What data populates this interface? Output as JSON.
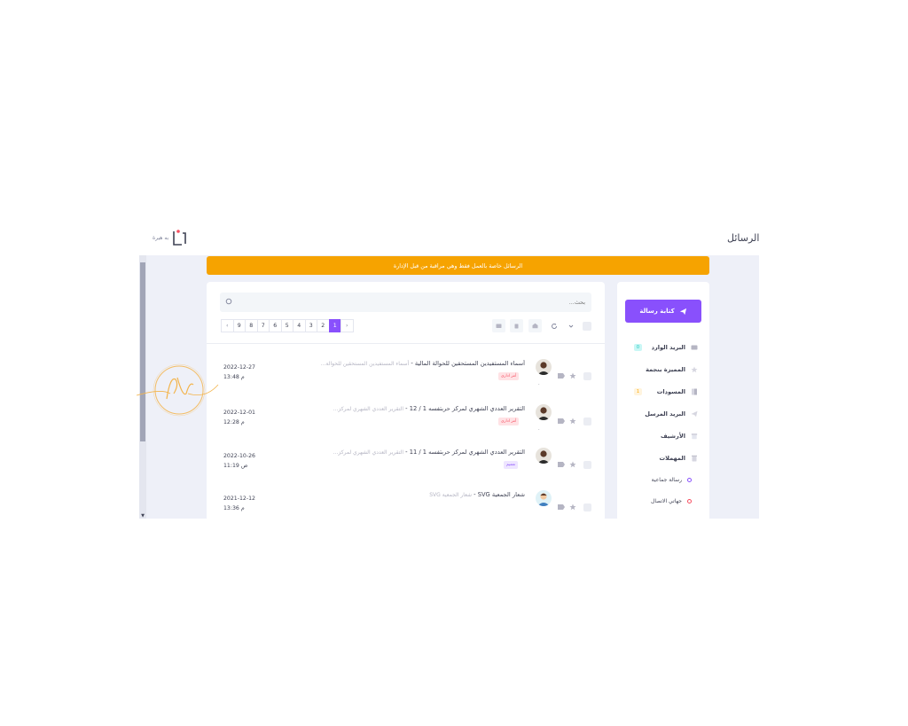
{
  "page": {
    "title": "الرسائل"
  },
  "logo": {
    "text": "به هيرة"
  },
  "notice": {
    "text": "الرسائل خاصة بالعمل فقط وهي مراقبة من قبل الإدارة"
  },
  "sidebar": {
    "compose_label": "كتابة رسالة",
    "items": [
      {
        "label": "البريد الوارد",
        "badge": "0",
        "icon": "inbox-icon"
      },
      {
        "label": "المميزة بنجمة",
        "badge": "",
        "icon": "star-icon"
      },
      {
        "label": "المسودات",
        "badge": "1",
        "icon": "draft-icon"
      },
      {
        "label": "البريد المرسل",
        "badge": "",
        "icon": "send-icon"
      },
      {
        "label": "الأرشيف",
        "badge": "",
        "icon": "archive-icon"
      },
      {
        "label": "المهملات",
        "badge": "",
        "icon": "trash-icon"
      }
    ],
    "labels": [
      {
        "label": "رسالة جماعية",
        "color": "#8950fc"
      },
      {
        "label": "جهاتي الاتصال",
        "color": "#f64e60"
      }
    ]
  },
  "search": {
    "placeholder": "بحث..."
  },
  "pagination": {
    "pages": [
      "1",
      "2",
      "3",
      "4",
      "5",
      "6",
      "7",
      "8",
      "9"
    ],
    "current": "1",
    "prev": "‹",
    "next": "›"
  },
  "messages": [
    {
      "subject": "أسماء المستفيدين المستحقين للحوالة المالية",
      "snippet": "أسماء المستفيدين المستحقين للحوالة...",
      "label": "أمر اداري",
      "label_color": "red",
      "date": "2022-12-27",
      "time": "13:48 م"
    },
    {
      "subject": "التقرير العددي الشهري لمركز حربتفسه 1 / 12",
      "snippet": "التقرير العددي الشهري لمركز...",
      "label": "أمر اداري",
      "label_color": "red",
      "date": "2022-12-01",
      "time": "12:28 م"
    },
    {
      "subject": "التقرير العددي الشهري لمركز حربتفسه 1 / 11",
      "snippet": "التقرير العددي الشهري لمركز...",
      "label": "تعميم",
      "label_color": "purple",
      "date": "2022-10-26",
      "time": "11:19 ص"
    },
    {
      "subject": "شعار الجمعية SVG",
      "snippet": "شعار الجمعية SVG",
      "label": "",
      "label_color": "",
      "date": "2021-12-12",
      "time": "13:36 م"
    }
  ],
  "colors": {
    "accent": "#8950fc",
    "notice": "#f6a300",
    "danger": "#f64e60",
    "success": "#1bc5bd"
  }
}
